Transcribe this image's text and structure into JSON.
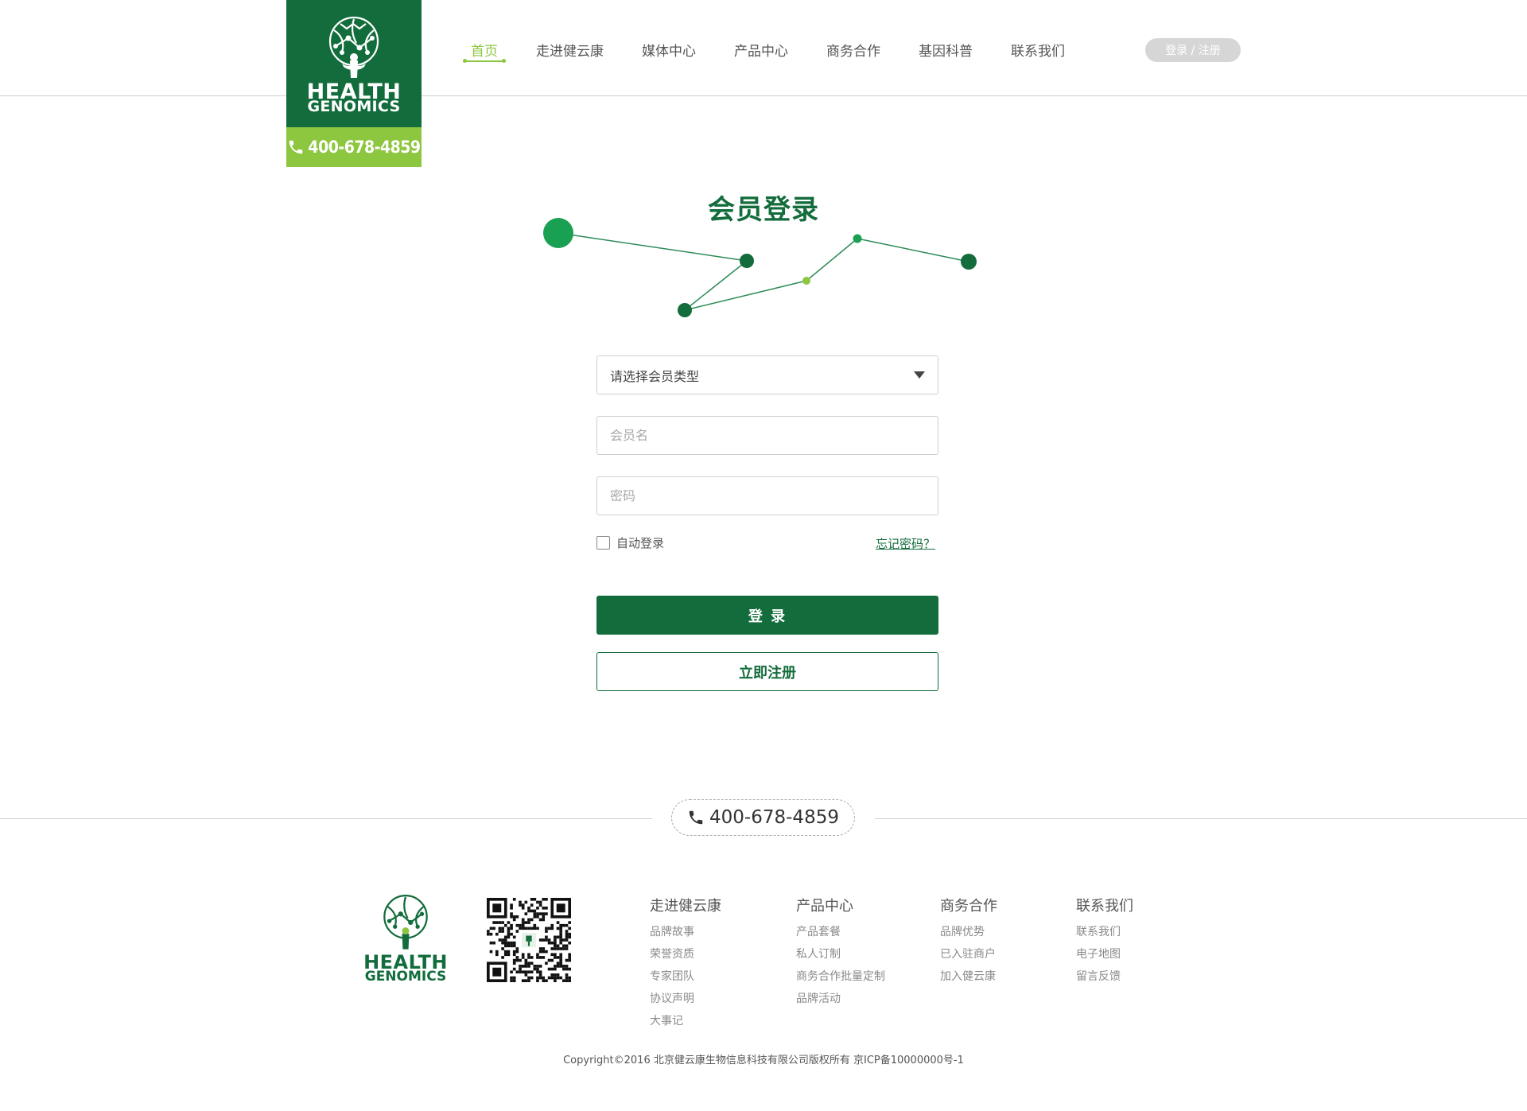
{
  "brand": {
    "logo_line1": "HEALTH",
    "logo_line2": "GENOMICS",
    "phone": "400-678-4859",
    "primary_color": "#126c3b",
    "accent_color": "#8dc63f"
  },
  "nav": {
    "items": [
      {
        "label": "首页",
        "active": true
      },
      {
        "label": "走进健云康",
        "active": false
      },
      {
        "label": "媒体中心",
        "active": false
      },
      {
        "label": "产品中心",
        "active": false
      },
      {
        "label": "商务合作",
        "active": false
      },
      {
        "label": "基因科普",
        "active": false
      },
      {
        "label": "联系我们",
        "active": false
      }
    ],
    "login_register": "登录 / 注册"
  },
  "login": {
    "title": "会员登录",
    "member_type_select": "请选择会员类型",
    "username_placeholder": "会员名",
    "password_placeholder": "密码",
    "auto_login": "自动登录",
    "forgot_password": "忘记密码？",
    "login_button": "登 录",
    "register_button": "立即注册"
  },
  "footer": {
    "phone": "400-678-4859",
    "logo_line1": "HEALTH",
    "logo_line2": "GENOMICS",
    "columns": [
      {
        "title": "走进健云康",
        "links": [
          "品牌故事",
          "荣誉资质",
          "专家团队",
          "协议声明",
          "大事记"
        ]
      },
      {
        "title": "产品中心",
        "links": [
          "产品套餐",
          "私人订制",
          "商务合作批量定制",
          "品牌活动"
        ]
      },
      {
        "title": "商务合作",
        "links": [
          "品牌优势",
          "已入驻商户",
          "加入健云康"
        ]
      },
      {
        "title": "联系我们",
        "links": [
          "联系我们",
          "电子地图",
          "留言反馈"
        ]
      }
    ],
    "copyright": "Copyright©2016 北京健云康生物信息科技有限公司版权所有  京ICP备10000000号-1"
  },
  "icons": {
    "phone": "phone-icon",
    "tree_logo": "tree-logo-icon",
    "dropdown": "chevron-down-icon",
    "qr": "qr-code"
  }
}
